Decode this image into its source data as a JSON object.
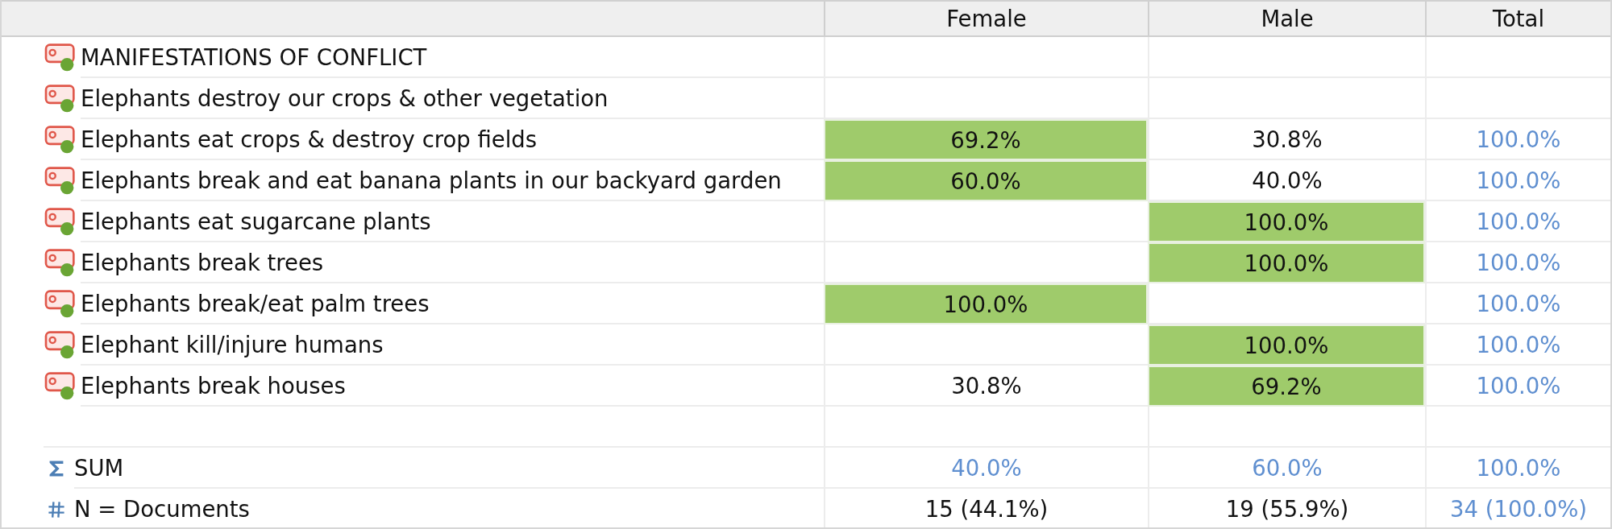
{
  "table": {
    "columns": [
      "Female",
      "Male",
      "Total"
    ],
    "rows": [
      {
        "kind": "code",
        "label": "MANIFESTATIONS OF CONFLICT",
        "cells": []
      },
      {
        "kind": "code",
        "label": "Elephants destroy our crops & other vegetation",
        "cells": []
      },
      {
        "kind": "code",
        "label": "Elephants eat crops & destroy crop fields",
        "cells": [
          {
            "text": "69.2%",
            "highlighted": true,
            "kind": "value"
          },
          {
            "text": "30.8%",
            "highlighted": false,
            "kind": "value"
          },
          {
            "text": "100.0%",
            "highlighted": false,
            "kind": "total"
          }
        ]
      },
      {
        "kind": "code",
        "label": "Elephants break and eat banana plants in our backyard garden",
        "cells": [
          {
            "text": "60.0%",
            "highlighted": true,
            "kind": "value"
          },
          {
            "text": "40.0%",
            "highlighted": false,
            "kind": "value"
          },
          {
            "text": "100.0%",
            "highlighted": false,
            "kind": "total"
          }
        ]
      },
      {
        "kind": "code",
        "label": "Elephants eat sugarcane plants",
        "cells": [
          {
            "text": "",
            "highlighted": false,
            "kind": "value"
          },
          {
            "text": "100.0%",
            "highlighted": true,
            "kind": "value"
          },
          {
            "text": "100.0%",
            "highlighted": false,
            "kind": "total"
          }
        ]
      },
      {
        "kind": "code",
        "label": "Elephants break trees",
        "cells": [
          {
            "text": "",
            "highlighted": false,
            "kind": "value"
          },
          {
            "text": "100.0%",
            "highlighted": true,
            "kind": "value"
          },
          {
            "text": "100.0%",
            "highlighted": false,
            "kind": "total"
          }
        ]
      },
      {
        "kind": "code",
        "label": "Elephants break/eat palm trees",
        "cells": [
          {
            "text": "100.0%",
            "highlighted": true,
            "kind": "value"
          },
          {
            "text": "",
            "highlighted": false,
            "kind": "value"
          },
          {
            "text": "100.0%",
            "highlighted": false,
            "kind": "total"
          }
        ]
      },
      {
        "kind": "code",
        "label": "Elephant kill/injure humans",
        "cells": [
          {
            "text": "",
            "highlighted": false,
            "kind": "value"
          },
          {
            "text": "100.0%",
            "highlighted": true,
            "kind": "value"
          },
          {
            "text": "100.0%",
            "highlighted": false,
            "kind": "total"
          }
        ]
      },
      {
        "kind": "code",
        "label": "Elephants break houses",
        "cells": [
          {
            "text": "30.8%",
            "highlighted": false,
            "kind": "value"
          },
          {
            "text": "69.2%",
            "highlighted": true,
            "kind": "value"
          },
          {
            "text": "100.0%",
            "highlighted": false,
            "kind": "total"
          }
        ]
      },
      {
        "kind": "blank",
        "cells": []
      },
      {
        "kind": "sum",
        "label": "SUM",
        "cells": [
          {
            "text": "40.0%",
            "highlighted": false,
            "kind": "total"
          },
          {
            "text": "60.0%",
            "highlighted": false,
            "kind": "total"
          },
          {
            "text": "100.0%",
            "highlighted": false,
            "kind": "total"
          }
        ]
      },
      {
        "kind": "count",
        "label": "N = Documents",
        "cells": [
          {
            "text": "15 (44.1%)",
            "highlighted": false,
            "kind": "value"
          },
          {
            "text": "19 (55.9%)",
            "highlighted": false,
            "kind": "value"
          },
          {
            "text": "34 (100.0%)",
            "highlighted": false,
            "kind": "total"
          }
        ]
      }
    ]
  }
}
